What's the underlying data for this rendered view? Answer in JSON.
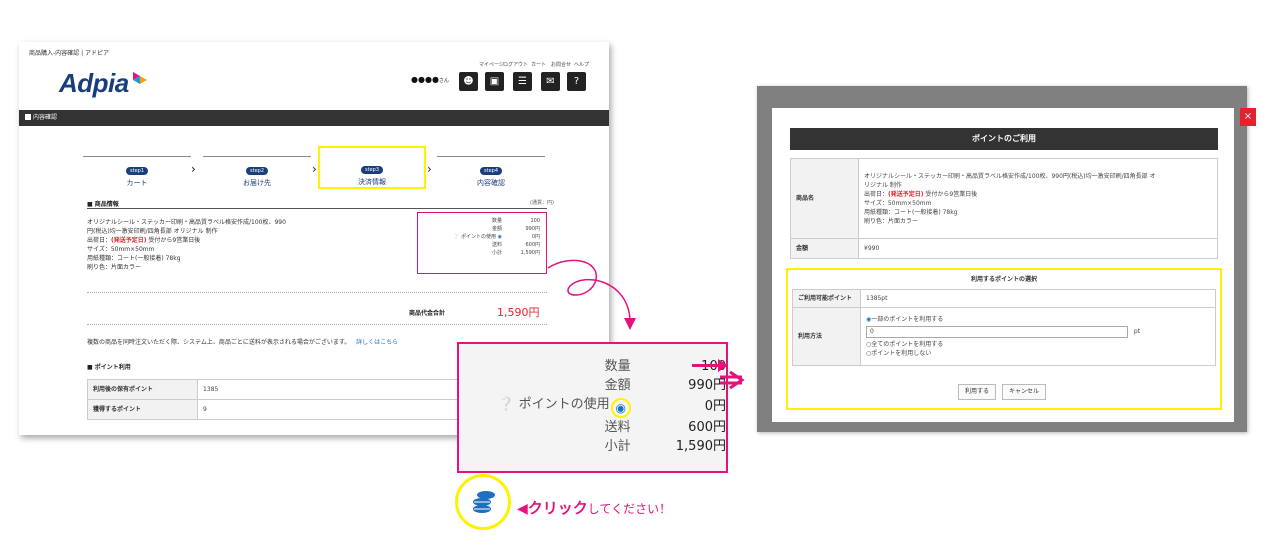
{
  "left_page": {
    "breadcrumb": "商品購入-内容確認 | アドピア",
    "logo": "Adpia",
    "top_links": [
      "マイページ",
      "ログアウト",
      "カート",
      "お問合せ",
      "ヘルプ"
    ],
    "user_name": "●●●●",
    "user_suffix": "さん",
    "section_bar": "内容確認",
    "steps": [
      {
        "badge": "step1",
        "label": "カート"
      },
      {
        "badge": "step2",
        "label": "お届け先"
      },
      {
        "badge": "step3",
        "label": "決済情報"
      },
      {
        "badge": "step4",
        "label": "内容確認"
      }
    ],
    "product_section": "■ 商品情報",
    "currency_note": "(通貨：円)",
    "product_lines": [
      "オリジナルシール・ステッカー印刷・高品質ラベル格安作成/100枚、990",
      "円(税込)均一激安印刷/四角長部 オリジナル 制作"
    ],
    "ship_prefix": "出荷日：",
    "ship_date": "(発送予定日)",
    "ship_suffix": " 受付から9営業日後",
    "size": "サイズ：50mm×50mm",
    "paper": "用紙種類：コート(一般接着) 78kg",
    "color": "刷り色：片面カラー",
    "summary": [
      {
        "key": "数量",
        "value": "100"
      },
      {
        "key": "金額",
        "value": "990円"
      },
      {
        "key": "ポイントの使用",
        "value": "0円"
      },
      {
        "key": "送料",
        "value": "600円"
      },
      {
        "key": "小計",
        "value": "1,590円"
      }
    ],
    "total_label": "商品代金合計",
    "total_value": "1,590円",
    "notice": "複数の商品を同時注文いただく際、システム上、商品ごとに送料が表示される場合がございます。",
    "notice_link": "詳しくはこちら",
    "points_section": "■ ポイント利用",
    "points_rows": [
      {
        "label": "利用後の保有ポイント",
        "value": "1385"
      },
      {
        "label": "獲得するポイント",
        "value": "9"
      }
    ]
  },
  "zoom": {
    "rows": [
      {
        "key": "数量",
        "value": "100"
      },
      {
        "key": "金額",
        "value": "990円"
      },
      {
        "key": "ポイントの使用",
        "value": "0円"
      },
      {
        "key": "送料",
        "value": "600円"
      },
      {
        "key": "小計",
        "value": "1,590円"
      }
    ]
  },
  "callout": {
    "click_text": "クリック",
    "click_suffix": "してください！"
  },
  "modal": {
    "title": "ポイントのご利用",
    "product_label": "商品名",
    "product_lines": [
      "オリジナルシール・ステッカー印刷・高品質ラベル格安作成/100枚、990円(税込)均一激安印刷/四角長部 オ",
      "リジナル 制作"
    ],
    "ship_prefix": "出荷日：",
    "ship_date": "(発送予定日)",
    "ship_suffix": " 受付から9営業日後",
    "size": "サイズ：50mm×50mm",
    "paper": "用紙種類：コート(一般接着) 78kg",
    "color": "刷り色：片面カラー",
    "amount_label": "金額",
    "amount_value": "¥990",
    "select_title": "利用するポイントの選択",
    "available_label": "ご利用可能ポイント",
    "available_value": "1385pt",
    "method_label": "利用方法",
    "options": [
      "一部のポイントを利用する",
      "全てのポイントを利用する",
      "ポイントを利用しない"
    ],
    "input_value": "0",
    "unit": "pt",
    "use_button": "利用する",
    "cancel_button": "キャンセル",
    "close": "×"
  },
  "colors": {
    "accent": "#e4137b",
    "highlight": "#fff200",
    "brand": "#1a3d7c",
    "coin": "#1f6fbf"
  }
}
